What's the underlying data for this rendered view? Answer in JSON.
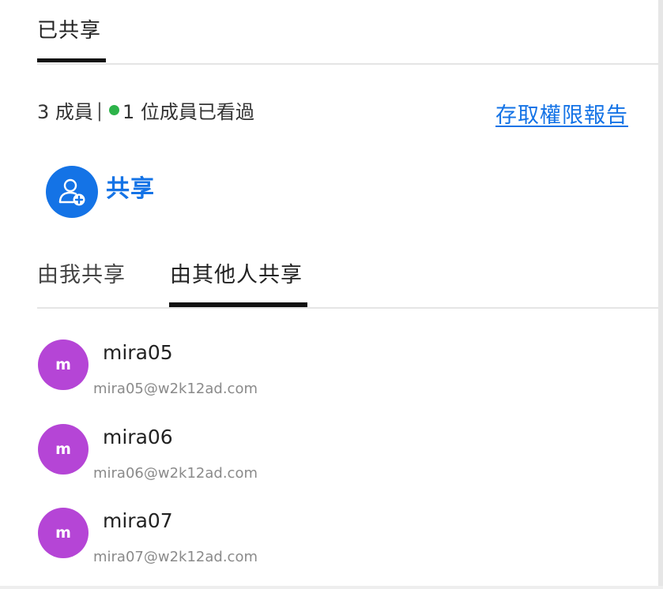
{
  "header": {
    "tab_label": "已共享"
  },
  "summary": {
    "members_text": "3 成員",
    "separator": "|",
    "viewed_text": "1 位成員已看過",
    "access_report_link": "存取權限報告",
    "viewed_dot_color": "#2db34a"
  },
  "share": {
    "icon": "add-user-icon",
    "label": "共享",
    "accent_color": "#1473e6"
  },
  "subtabs": [
    {
      "label": "由我共享",
      "active": false
    },
    {
      "label": "由其他人共享",
      "active": true
    }
  ],
  "members": [
    {
      "initial": "m",
      "name": "mira05",
      "email": "mira05@w2k12ad.com"
    },
    {
      "initial": "m",
      "name": "mira06",
      "email": "mira06@w2k12ad.com"
    },
    {
      "initial": "m",
      "name": "mira07",
      "email": "mira07@w2k12ad.com"
    }
  ],
  "colors": {
    "avatar": "#b545d6",
    "link": "#1473e6"
  }
}
